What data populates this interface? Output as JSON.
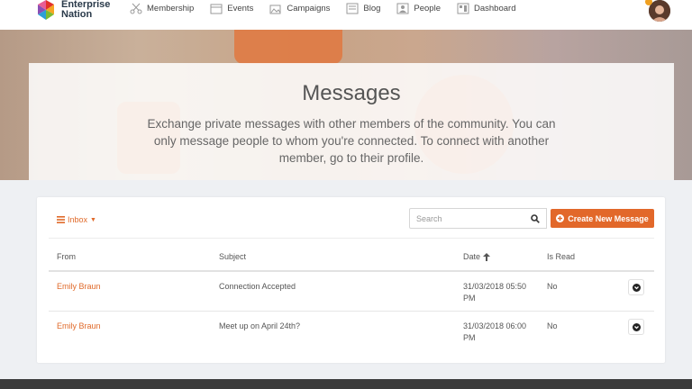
{
  "brand": {
    "name_line1": "Enterprise",
    "name_line2": "Nation"
  },
  "nav": [
    {
      "label": "Membership",
      "icon": "scissors-icon"
    },
    {
      "label": "Events",
      "icon": "calendar-icon"
    },
    {
      "label": "Campaigns",
      "icon": "image-icon"
    },
    {
      "label": "Blog",
      "icon": "blog-icon"
    },
    {
      "label": "People",
      "icon": "person-icon"
    },
    {
      "label": "Dashboard",
      "icon": "dashboard-icon"
    }
  ],
  "hero": {
    "title": "Messages",
    "description": "Exchange private messages with other members of the community. You can only message people to whom you're connected. To connect with another member, go to their profile."
  },
  "toolbar": {
    "inbox_label": "Inbox",
    "search_placeholder": "Search",
    "create_label": "Create New Message"
  },
  "table": {
    "headers": {
      "from": "From",
      "subject": "Subject",
      "date": "Date",
      "is_read": "Is Read"
    },
    "rows": [
      {
        "from": "Emily Braun",
        "subject": "Connection Accepted",
        "date_line1": "31/03/2018 05:50",
        "date_line2": "PM",
        "is_read": "No"
      },
      {
        "from": "Emily Braun",
        "subject": "Meet up on April 24th?",
        "date_line1": "31/03/2018 06:00",
        "date_line2": "PM",
        "is_read": "No"
      }
    ]
  },
  "colors": {
    "accent": "#e2682a",
    "link": "#e06a2a",
    "footer": "#3b3b3b"
  }
}
